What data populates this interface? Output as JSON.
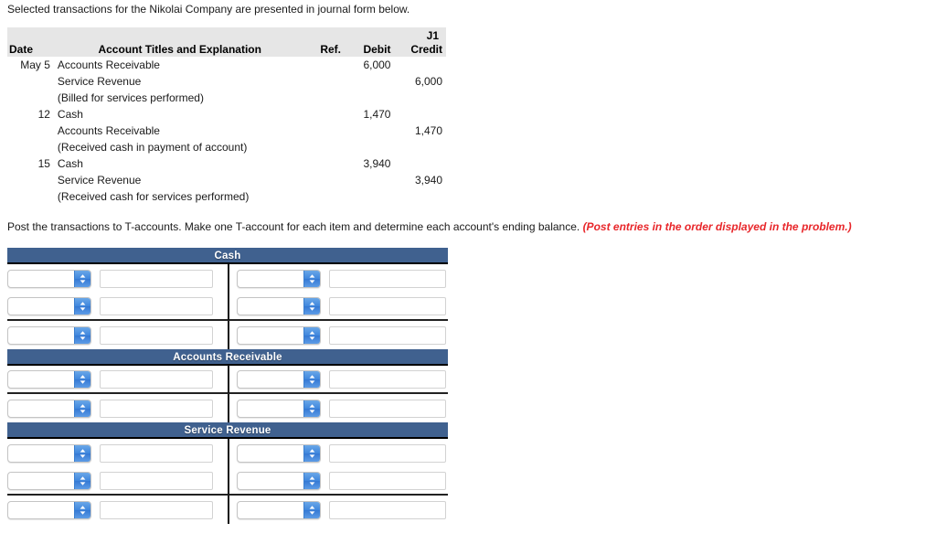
{
  "intro": "Selected transactions for the Nikolai Company are presented in journal form below.",
  "journal": {
    "page_ref": "J1",
    "columns": {
      "date": "Date",
      "account": "Account Titles and Explanation",
      "ref": "Ref.",
      "debit": "Debit",
      "credit": "Credit"
    },
    "rows": [
      {
        "date": "May 5",
        "account": "Accounts Receivable",
        "indent": 0,
        "ref": "",
        "debit": "6,000",
        "credit": ""
      },
      {
        "date": "",
        "account": "Service Revenue",
        "indent": 1,
        "ref": "",
        "debit": "",
        "credit": "6,000"
      },
      {
        "date": "",
        "account": "(Billed for services performed)",
        "indent": 2,
        "ref": "",
        "debit": "",
        "credit": ""
      },
      {
        "date": "12",
        "account": "Cash",
        "indent": 0,
        "ref": "",
        "debit": "1,470",
        "credit": ""
      },
      {
        "date": "",
        "account": "Accounts Receivable",
        "indent": 1,
        "ref": "",
        "debit": "",
        "credit": "1,470"
      },
      {
        "date": "",
        "account": "(Received cash in payment of account)",
        "indent": 2,
        "ref": "",
        "debit": "",
        "credit": ""
      },
      {
        "date": "15",
        "account": "Cash",
        "indent": 0,
        "ref": "",
        "debit": "3,940",
        "credit": ""
      },
      {
        "date": "",
        "account": "Service Revenue",
        "indent": 1,
        "ref": "",
        "debit": "",
        "credit": "3,940"
      },
      {
        "date": "",
        "account": "(Received cash for services performed)",
        "indent": 2,
        "ref": "",
        "debit": "",
        "credit": ""
      }
    ]
  },
  "instruction": {
    "text": "Post the transactions to T-accounts. Make one T-account for each item and determine each account's ending balance. ",
    "emphasis": "(Post entries in the order displayed in the problem.)"
  },
  "taccounts": [
    {
      "title": "Cash",
      "rows": [
        {
          "balance_line": false,
          "left": {
            "select": "",
            "amount": ""
          },
          "right": {
            "select": "",
            "amount": ""
          }
        },
        {
          "balance_line": true,
          "left": {
            "select": "",
            "amount": ""
          },
          "right": {
            "select": "",
            "amount": ""
          }
        },
        {
          "balance_line": false,
          "left": {
            "select": "",
            "amount": ""
          },
          "right": {
            "select": "",
            "amount": ""
          }
        }
      ]
    },
    {
      "title": "Accounts Receivable",
      "rows": [
        {
          "balance_line": true,
          "left": {
            "select": "",
            "amount": ""
          },
          "right": {
            "select": "",
            "amount": ""
          }
        },
        {
          "balance_line": false,
          "left": {
            "select": "",
            "amount": ""
          },
          "right": {
            "select": "",
            "amount": ""
          }
        }
      ]
    },
    {
      "title": "Service Revenue",
      "rows": [
        {
          "balance_line": false,
          "left": {
            "select": "",
            "amount": ""
          },
          "right": {
            "select": "",
            "amount": ""
          }
        },
        {
          "balance_line": true,
          "left": {
            "select": "",
            "amount": ""
          },
          "right": {
            "select": "",
            "amount": ""
          }
        },
        {
          "balance_line": false,
          "left": {
            "select": "",
            "amount": ""
          },
          "right": {
            "select": "",
            "amount": ""
          }
        }
      ]
    }
  ],
  "colors": {
    "header_bar": "#40618f",
    "journal_header_bg": "#e6e6e6",
    "emphasis_red": "#e8262a",
    "stepper_blue": "#3f86dd"
  }
}
